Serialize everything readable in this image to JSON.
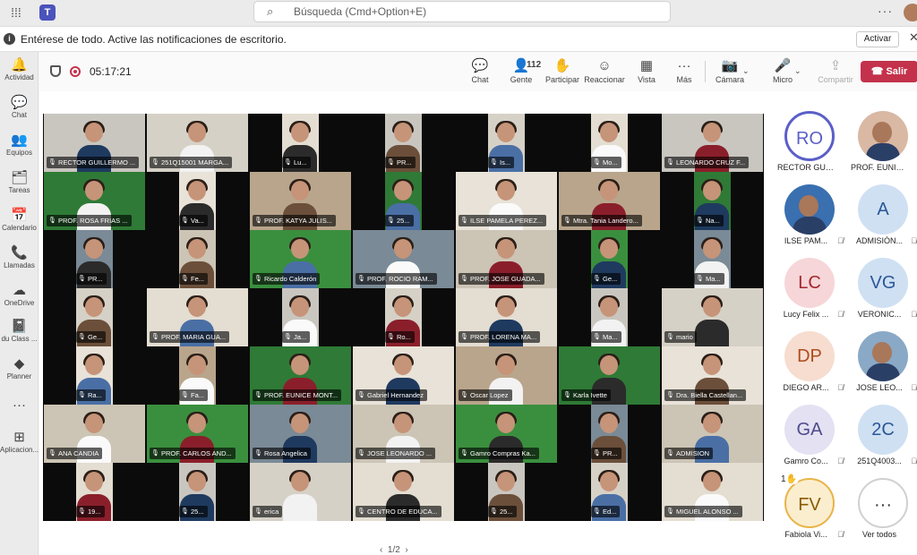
{
  "top": {
    "app_glyph": "T",
    "search_placeholder": "Búsqueda (Cmd+Option+E)",
    "more": "···"
  },
  "notification": {
    "text": "Entérese de todo. Active las notificaciones de escritorio.",
    "activate_label": "Activar",
    "close": "✕"
  },
  "rail": [
    {
      "label": "Actividad",
      "icon": "bell-icon",
      "glyph": "🔔"
    },
    {
      "label": "Chat",
      "icon": "chat-icon",
      "glyph": "💬"
    },
    {
      "label": "Equipos",
      "icon": "teams-icon",
      "glyph": "👥"
    },
    {
      "label": "Tareas",
      "icon": "tasks-icon",
      "glyph": "🗂"
    },
    {
      "label": "Calendario",
      "icon": "calendar-icon",
      "glyph": "📅"
    },
    {
      "label": "Llamadas",
      "icon": "phone-icon",
      "glyph": "📞"
    },
    {
      "label": "OneDrive",
      "icon": "cloud-icon",
      "glyph": "☁"
    },
    {
      "label": "du Class ...",
      "icon": "onenote-icon",
      "glyph": "📓"
    },
    {
      "label": "Planner",
      "icon": "planner-icon",
      "glyph": "◆"
    },
    {
      "label": "",
      "icon": "more-apps-icon",
      "glyph": "···"
    },
    {
      "label": "Aplicacion...",
      "icon": "apps-icon",
      "glyph": "⊞"
    }
  ],
  "meeting": {
    "timer": "05:17:21",
    "toolbar": [
      {
        "label": "Chat",
        "icon": "chat-icon",
        "glyph": "💬"
      },
      {
        "label": "Gente",
        "icon": "people-icon",
        "glyph": "👤",
        "count": "112"
      },
      {
        "label": "Participar",
        "icon": "raise-hand-icon",
        "glyph": "✋"
      },
      {
        "label": "Reaccionar",
        "icon": "smile-icon",
        "glyph": "☺"
      },
      {
        "label": "Vista",
        "icon": "grid-view-icon",
        "glyph": "▦"
      },
      {
        "label": "Más",
        "icon": "more-icon",
        "glyph": "···"
      },
      {
        "label": "Cámara",
        "icon": "camera-off-icon",
        "glyph": "📷"
      },
      {
        "label": "Micro",
        "icon": "mic-off-icon",
        "glyph": "🎤"
      },
      {
        "label": "Compartir",
        "icon": "share-icon",
        "glyph": "⇪"
      }
    ],
    "leave_label": "Salir",
    "pager": "1/2"
  },
  "video_tiles": [
    [
      "RECTOR GUILLERMO ...",
      "251Q15001 MARGA...",
      "Lu...",
      "PR...",
      "Is...",
      "Mo...",
      "LEONARDO CRUZ F..."
    ],
    [
      "PROF. ROSA FRIAS ...",
      "Va...",
      "PROF. KATYA JULIS...",
      "25...",
      "ILSE PAMELA PEREZ...",
      "Mtra. Tania Landero...",
      "Na..."
    ],
    [
      "PR...",
      "Fe...",
      "Ricardo Calderón",
      "PROF. ROCIO RAM...",
      "PROF. JOSE GUADA...",
      "Ge...",
      "Ma..."
    ],
    [
      "Ge...",
      "PROF. MARIA GUA...",
      "Ja...",
      "Ro...",
      "PROF. LORENA MA...",
      "Ma...",
      "mario"
    ],
    [
      "Ra...",
      "Fa...",
      "PROF. EUNICE MONT...",
      "Gabriel Hernandez",
      "Oscar Lopez",
      "Karla Ivette",
      "Dra. Biella Castellan..."
    ],
    [
      "ANA CANDIA",
      "PROF. CARLOS AND...",
      "Rosa Angelica",
      "JOSE LEONARDO ...",
      "Gamro Compras Ka...",
      "PR...",
      "ADMISION"
    ],
    [
      "19...",
      "25...",
      "erica",
      "CENTRO DE EDUCA...",
      "25...",
      "Ed...",
      "MIGUEL ALONSO ..."
    ]
  ],
  "roster": [
    {
      "initials": "RO",
      "name": "RECTOR GUIL...",
      "bg": "#ffffff",
      "fg": "#5b5fc7",
      "ring": "#5b5fc7",
      "muted": false
    },
    {
      "initials": "",
      "name": "PROF. EUNICE...",
      "bg": "#d9b8a4",
      "fg": "#333",
      "ring": "",
      "muted": false,
      "photo": true
    },
    {
      "initials": "",
      "name": "ILSE PAM...",
      "bg": "#3a6fb0",
      "fg": "#fff",
      "ring": "",
      "muted": true,
      "photo": true
    },
    {
      "initials": "A",
      "name": "ADMISIÓN...",
      "bg": "#cfe0f3",
      "fg": "#2b5797",
      "ring": "",
      "muted": true
    },
    {
      "initials": "LC",
      "name": "Lucy Felix ...",
      "bg": "#f6d6d8",
      "fg": "#a4262c",
      "ring": "",
      "muted": true
    },
    {
      "initials": "VG",
      "name": "VERONIC...",
      "bg": "#cfe0f3",
      "fg": "#2b5797",
      "ring": "",
      "muted": true
    },
    {
      "initials": "DP",
      "name": "DIEGO AR...",
      "bg": "#f6ddd0",
      "fg": "#b04a1c",
      "ring": "",
      "muted": true
    },
    {
      "initials": "",
      "name": "JOSE LEO...",
      "bg": "#8aa9c6",
      "fg": "#fff",
      "ring": "",
      "muted": true,
      "photo": true
    },
    {
      "initials": "GA",
      "name": "Gamro Co...",
      "bg": "#e3e1f2",
      "fg": "#4f4a8c",
      "ring": "",
      "muted": true
    },
    {
      "initials": "2C",
      "name": "251Q4003...",
      "bg": "#cfe0f3",
      "fg": "#2b5797",
      "ring": "",
      "muted": true
    },
    {
      "initials": "FV",
      "name": "Fabiola Vi...",
      "bg": "#fbeecf",
      "fg": "#8a5a00",
      "ring": "#e8b448",
      "muted": true,
      "hand": "1✋"
    },
    {
      "initials": "···",
      "name": "Ver todos",
      "bg": "#ffffff",
      "fg": "#333",
      "ring": "#d0d0d0",
      "muted": false
    }
  ],
  "colors": {
    "brand": "#5b5fc7",
    "leave": "#c4314b",
    "tile_green": "#2f8a3a",
    "grid_bg": "#0b0b0b"
  }
}
